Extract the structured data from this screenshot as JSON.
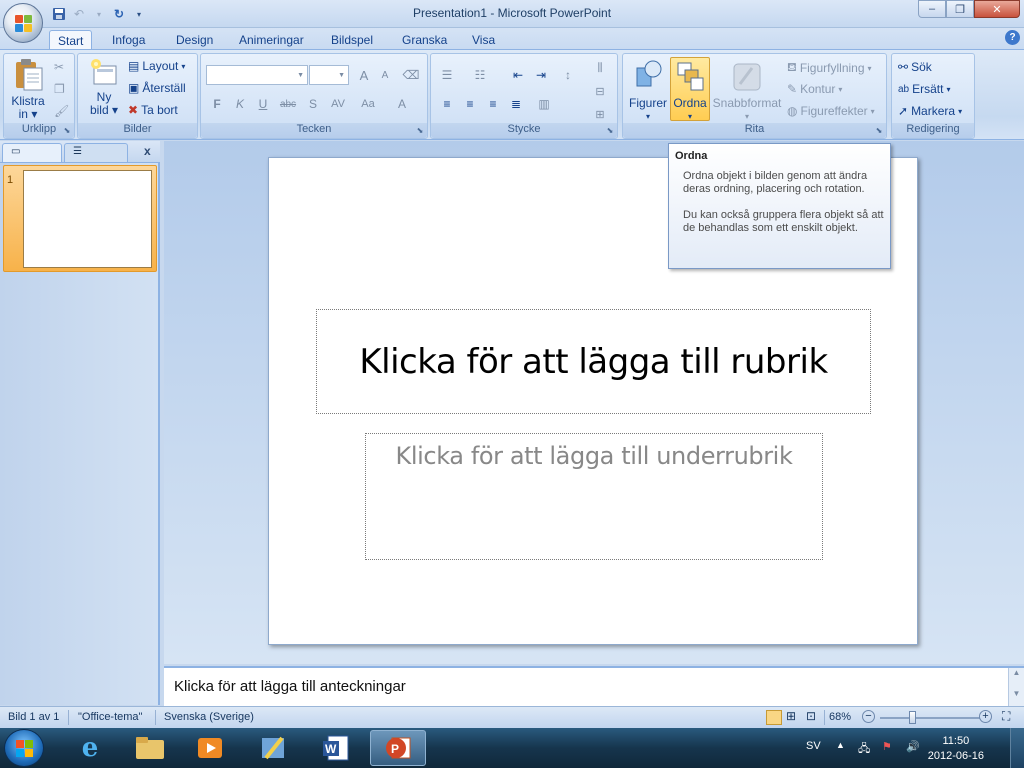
{
  "window": {
    "title": "Presentation1 - Microsoft PowerPoint",
    "minimize_label": "–",
    "maximize_label": "❐",
    "close_label": "✕"
  },
  "tabs": [
    "Start",
    "Infoga",
    "Design",
    "Animeringar",
    "Bildspel",
    "Granska",
    "Visa"
  ],
  "active_tab": "Start",
  "ribbon": {
    "urklipp": {
      "label": "Urklipp",
      "paste_label": "Klistra",
      "paste_label2": "in"
    },
    "bilder": {
      "label": "Bilder",
      "new_label": "Ny",
      "new_label2": "bild",
      "layout": "Layout",
      "reset": "Återställ",
      "delete": "Ta bort"
    },
    "tecken": {
      "label": "Tecken",
      "buttons": [
        "F",
        "K",
        "U",
        "abc",
        "S",
        "AV",
        "Aa",
        "A"
      ],
      "grow": "A",
      "shrink": "A"
    },
    "stycke": {
      "label": "Stycke"
    },
    "rita": {
      "label": "Rita",
      "shapes": "Figurer",
      "arrange": "Ordna",
      "quickstyles": "Snabbformat",
      "fill": "Figurfyllning",
      "outline": "Kontur",
      "effects": "Figureffekter"
    },
    "redigering": {
      "label": "Redigering",
      "find": "Sök",
      "replace": "Ersätt",
      "select": "Markera"
    }
  },
  "tooltip": {
    "title": "Ordna",
    "p1": "Ordna objekt i bilden genom att ändra deras ordning, placering och rotation.",
    "p2": "Du kan också gruppera flera objekt så att de behandlas som ett enskilt objekt."
  },
  "slides_pane": {
    "slide_number": "1",
    "close_label": "x"
  },
  "slide": {
    "title_placeholder": "Klicka för att lägga till rubrik",
    "subtitle_placeholder": "Klicka för att lägga till underrubrik"
  },
  "notes": {
    "placeholder": "Klicka för att lägga till anteckningar"
  },
  "statusbar": {
    "slide_info": "Bild 1 av 1",
    "theme": "\"Office-tema\"",
    "language": "Svenska (Sverige)",
    "zoom": "68%",
    "zoom_level_percent": 68
  },
  "taskbar": {
    "lang": "SV",
    "time": "11:50",
    "date": "2012-06-16"
  },
  "colors": {
    "accent_orange": "#f7b24a",
    "ribbon_blue": "#c6d9f0",
    "taskbar": "#16354d"
  }
}
